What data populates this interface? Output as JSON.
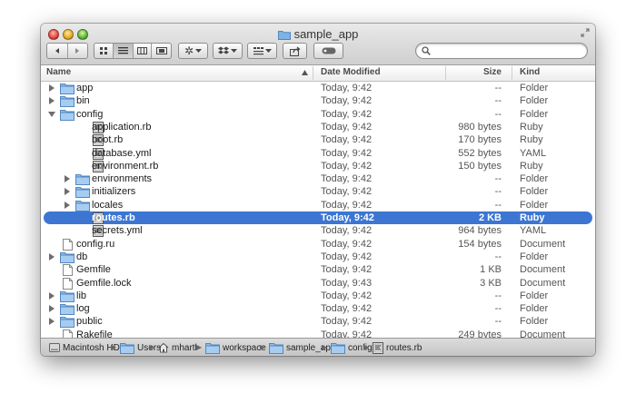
{
  "window": {
    "title": "sample_app"
  },
  "search": {
    "placeholder": "",
    "value": ""
  },
  "columns": {
    "name": "Name",
    "date": "Date Modified",
    "size": "Size",
    "kind": "Kind"
  },
  "colors": {
    "selection": "#3c76d2",
    "folder": "#7fb2e5"
  },
  "rows": [
    {
      "name": "app",
      "date": "Today, 9:42",
      "size": "--",
      "kind": "Folder",
      "type": "folder",
      "level": 0,
      "disclosure": "closed"
    },
    {
      "name": "bin",
      "date": "Today, 9:42",
      "size": "--",
      "kind": "Folder",
      "type": "folder",
      "level": 0,
      "disclosure": "closed"
    },
    {
      "name": "config",
      "date": "Today, 9:42",
      "size": "--",
      "kind": "Folder",
      "type": "folder",
      "level": 0,
      "disclosure": "open"
    },
    {
      "name": "application.rb",
      "date": "Today, 9:42",
      "size": "980 bytes",
      "kind": "Ruby",
      "type": "script",
      "level": 1,
      "disclosure": "none"
    },
    {
      "name": "boot.rb",
      "date": "Today, 9:42",
      "size": "170 bytes",
      "kind": "Ruby",
      "type": "script",
      "level": 1,
      "disclosure": "none"
    },
    {
      "name": "database.yml",
      "date": "Today, 9:42",
      "size": "552 bytes",
      "kind": "YAML",
      "type": "script",
      "level": 1,
      "disclosure": "none"
    },
    {
      "name": "environment.rb",
      "date": "Today, 9:42",
      "size": "150 bytes",
      "kind": "Ruby",
      "type": "script",
      "level": 1,
      "disclosure": "none"
    },
    {
      "name": "environments",
      "date": "Today, 9:42",
      "size": "--",
      "kind": "Folder",
      "type": "folder",
      "level": 1,
      "disclosure": "closed"
    },
    {
      "name": "initializers",
      "date": "Today, 9:42",
      "size": "--",
      "kind": "Folder",
      "type": "folder",
      "level": 1,
      "disclosure": "closed"
    },
    {
      "name": "locales",
      "date": "Today, 9:42",
      "size": "--",
      "kind": "Folder",
      "type": "folder",
      "level": 1,
      "disclosure": "closed"
    },
    {
      "name": "routes.rb",
      "date": "Today, 9:42",
      "size": "2 KB",
      "kind": "Ruby",
      "type": "script",
      "level": 1,
      "disclosure": "none",
      "selected": true
    },
    {
      "name": "secrets.yml",
      "date": "Today, 9:42",
      "size": "964 bytes",
      "kind": "YAML",
      "type": "script",
      "level": 1,
      "disclosure": "none"
    },
    {
      "name": "config.ru",
      "date": "Today, 9:42",
      "size": "154 bytes",
      "kind": "Document",
      "type": "doc",
      "level": 0,
      "disclosure": "none"
    },
    {
      "name": "db",
      "date": "Today, 9:42",
      "size": "--",
      "kind": "Folder",
      "type": "folder",
      "level": 0,
      "disclosure": "closed"
    },
    {
      "name": "Gemfile",
      "date": "Today, 9:42",
      "size": "1 KB",
      "kind": "Document",
      "type": "doc",
      "level": 0,
      "disclosure": "none"
    },
    {
      "name": "Gemfile.lock",
      "date": "Today, 9:43",
      "size": "3 KB",
      "kind": "Document",
      "type": "doc",
      "level": 0,
      "disclosure": "none"
    },
    {
      "name": "lib",
      "date": "Today, 9:42",
      "size": "--",
      "kind": "Folder",
      "type": "folder",
      "level": 0,
      "disclosure": "closed"
    },
    {
      "name": "log",
      "date": "Today, 9:42",
      "size": "--",
      "kind": "Folder",
      "type": "folder",
      "level": 0,
      "disclosure": "closed"
    },
    {
      "name": "public",
      "date": "Today, 9:42",
      "size": "--",
      "kind": "Folder",
      "type": "folder",
      "level": 0,
      "disclosure": "closed"
    },
    {
      "name": "Rakefile",
      "date": "Today, 9:42",
      "size": "249 bytes",
      "kind": "Document",
      "type": "doc",
      "level": 0,
      "disclosure": "none"
    }
  ],
  "path_bar": [
    {
      "label": "Macintosh HD",
      "icon": "disk-icon"
    },
    {
      "label": "Users",
      "icon": "folder-icon"
    },
    {
      "label": "mhartl",
      "icon": "home-icon"
    },
    {
      "label": "workspace",
      "icon": "folder-icon"
    },
    {
      "label": "sample_app",
      "icon": "folder-icon"
    },
    {
      "label": "config",
      "icon": "folder-icon"
    },
    {
      "label": "routes.rb",
      "icon": "script-icon"
    }
  ]
}
